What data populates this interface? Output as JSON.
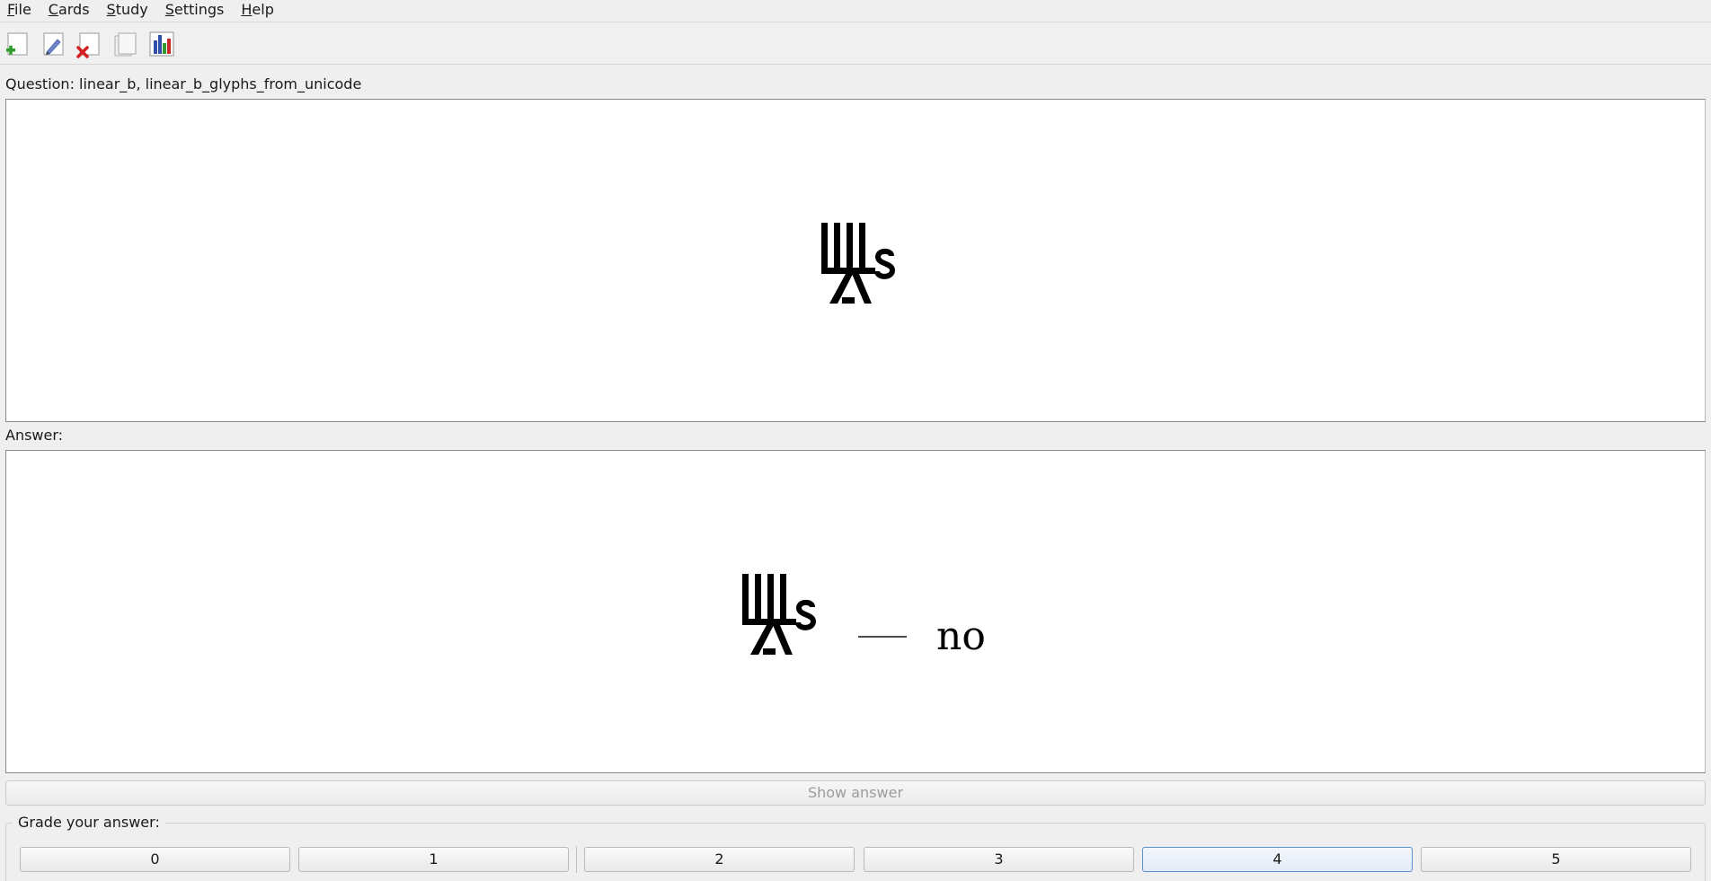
{
  "menubar": {
    "items": [
      {
        "mnemonic": "F",
        "rest": "ile"
      },
      {
        "mnemonic": "C",
        "rest": "ards"
      },
      {
        "mnemonic": "S",
        "rest": "tudy"
      },
      {
        "mnemonic": "S",
        "rest": "ettings"
      },
      {
        "mnemonic": "H",
        "rest": "elp"
      }
    ]
  },
  "toolbar": {
    "icons": [
      "add-card-icon",
      "edit-card-icon",
      "delete-card-icon",
      "browse-cards-icon",
      "statistics-icon"
    ]
  },
  "question": {
    "label": "Question: linear_b, linear_b_glyphs_from_unicode"
  },
  "answer": {
    "label": "Answer:",
    "transliteration": "no"
  },
  "show_answer": {
    "label": "Show answer"
  },
  "grading": {
    "title": "Grade your answer:",
    "buttons": [
      "0",
      "1",
      "2",
      "3",
      "4",
      "5"
    ],
    "focused": "4"
  },
  "colors": {
    "window_bg": "#efefef",
    "pane_bg": "#ffffff",
    "focus_border": "#5b8fd1",
    "disabled_text": "#9b9b9b"
  }
}
